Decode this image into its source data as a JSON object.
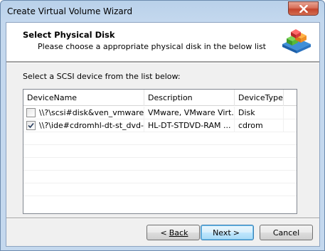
{
  "window": {
    "title": "Create Virtual Volume Wizard"
  },
  "header": {
    "title": "Select Physical Disk",
    "subtitle": "Please choose a appropriate physical disk in the below list",
    "icon": "stacked-cubes-icon"
  },
  "instruction": "Select a SCSI device from the list below:",
  "list": {
    "columns": [
      "DeviceName",
      "Description",
      "DeviceType"
    ],
    "rows": [
      {
        "checked": false,
        "device_name": "\\\\?\\scsi#disk&ven_vmware...",
        "description": "VMware, VMware Virt...",
        "device_type": "Disk"
      },
      {
        "checked": true,
        "device_name": "\\\\?\\ide#cdromhl-dt-st_dvd-r...",
        "description": "HL-DT-STDVD-RAM ...",
        "device_type": "cdrom"
      }
    ]
  },
  "buttons": {
    "back_label": "Back",
    "back_arrow": "<",
    "next_label": "Next",
    "next_arrow": ">",
    "cancel_label": "Cancel"
  },
  "colors": {
    "title_bar": "#c4d8ee",
    "close_button": "#c4442c",
    "default_button_border": "#3c7fb1"
  }
}
